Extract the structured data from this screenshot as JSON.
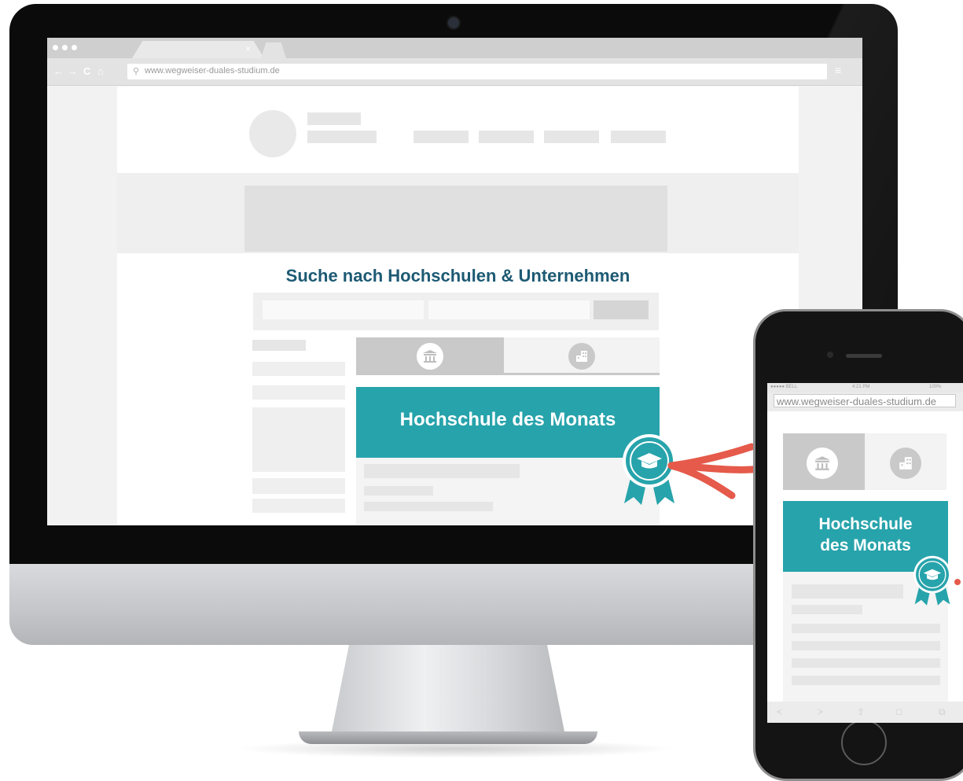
{
  "browser": {
    "url": "www.wegweiser-duales-studium.de",
    "tab_close": "×",
    "back_icon": "←",
    "forward_icon": "→",
    "reload_icon": "C",
    "home_icon": "⌂",
    "search_icon": "⚲",
    "menu_icon": "≡"
  },
  "desktop_page": {
    "headline": "Suche nach Hochschulen & Unternehmen",
    "featured_title": "Hochschule des Monats"
  },
  "phone": {
    "status_carrier": "●●●●● BELL",
    "status_time": "4:21 PM",
    "status_battery": "100%",
    "url": "www.wegweiser-duales-studium.de",
    "featured_title_line1": "Hochschule",
    "featured_title_line2": "des Monats",
    "toolbar_icons": [
      "<",
      ">",
      "⇪",
      "□",
      "⧉"
    ]
  },
  "colors": {
    "accent_teal": "#27a3ab",
    "headline_blue": "#1d5a73",
    "arrow_red": "#e55a4a"
  }
}
